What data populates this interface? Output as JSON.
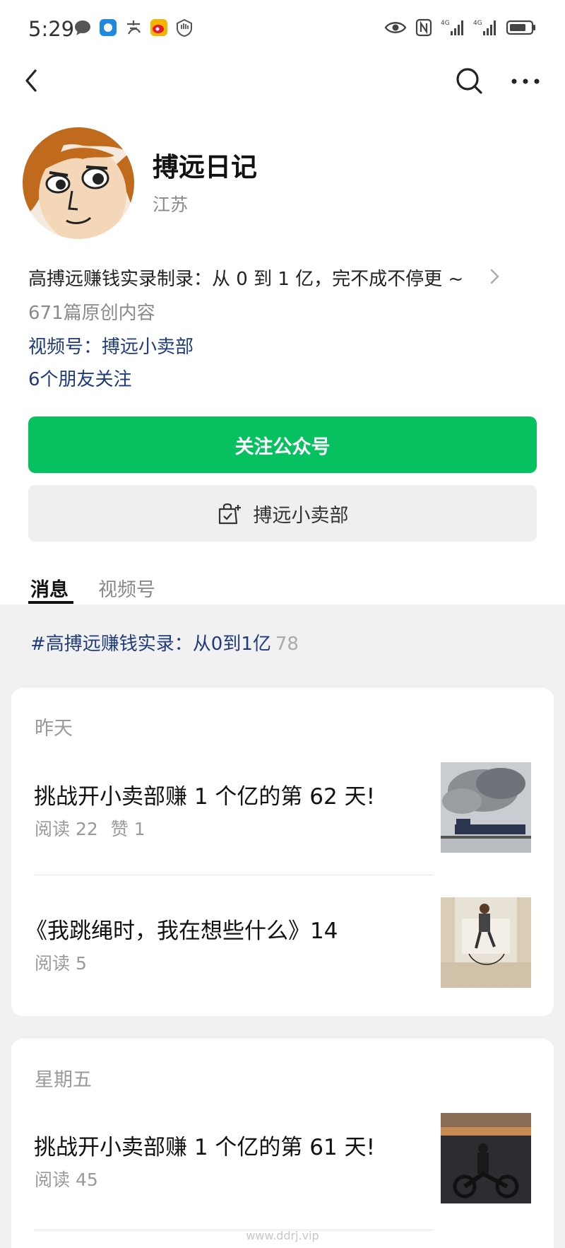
{
  "status_bar": {
    "time": "5:29",
    "left_icons": [
      "chat-bubble-icon",
      "weather-app-icon",
      "alipay-icon",
      "weibo-icon",
      "shield-app-icon"
    ],
    "right_icons": [
      "eye-icon",
      "nfc-icon",
      "signal-4g-icon",
      "signal-4g-icon",
      "battery-icon"
    ],
    "network_label": "4G"
  },
  "nav": {
    "back_icon": "chevron-left-icon",
    "search_icon": "search-icon",
    "more_icon": "more-horizontal-icon"
  },
  "profile": {
    "name": "搏远日记",
    "region": "江苏",
    "description": "高搏远赚钱实录制录：从 0 到 1 亿，完不成不停更 ~",
    "original_count": "671篇原创内容",
    "channel": "视频号：搏远小卖部",
    "friends_following": "6个朋友关注"
  },
  "buttons": {
    "follow_label": "关注公众号",
    "shop_label": "搏远小卖部",
    "follow_color": "#07c160"
  },
  "tabs": [
    {
      "label": "消息",
      "active": true
    },
    {
      "label": "视频号",
      "active": false
    }
  ],
  "hashtag": {
    "label": "#高搏远赚钱实录：从0到1亿",
    "count": "78"
  },
  "feed": [
    {
      "date": "昨天",
      "articles": [
        {
          "title": "挑战开小卖部赚 1 个亿的第 62 天!",
          "reads": "阅读 22",
          "likes": "赞 1",
          "thumb": "steam-train-photo"
        },
        {
          "title": "《我跳绳时，我在想些什么》14",
          "reads": "阅读 5",
          "likes": null,
          "thumb": "jump-rope-photo"
        }
      ]
    },
    {
      "date": "星期五",
      "articles": [
        {
          "title": "挑战开小卖部赚 1 个亿的第 61 天!",
          "reads": "阅读 45",
          "likes": null,
          "thumb": "motorcycle-photo"
        }
      ]
    }
  ],
  "watermark": "www.ddrj.vip"
}
